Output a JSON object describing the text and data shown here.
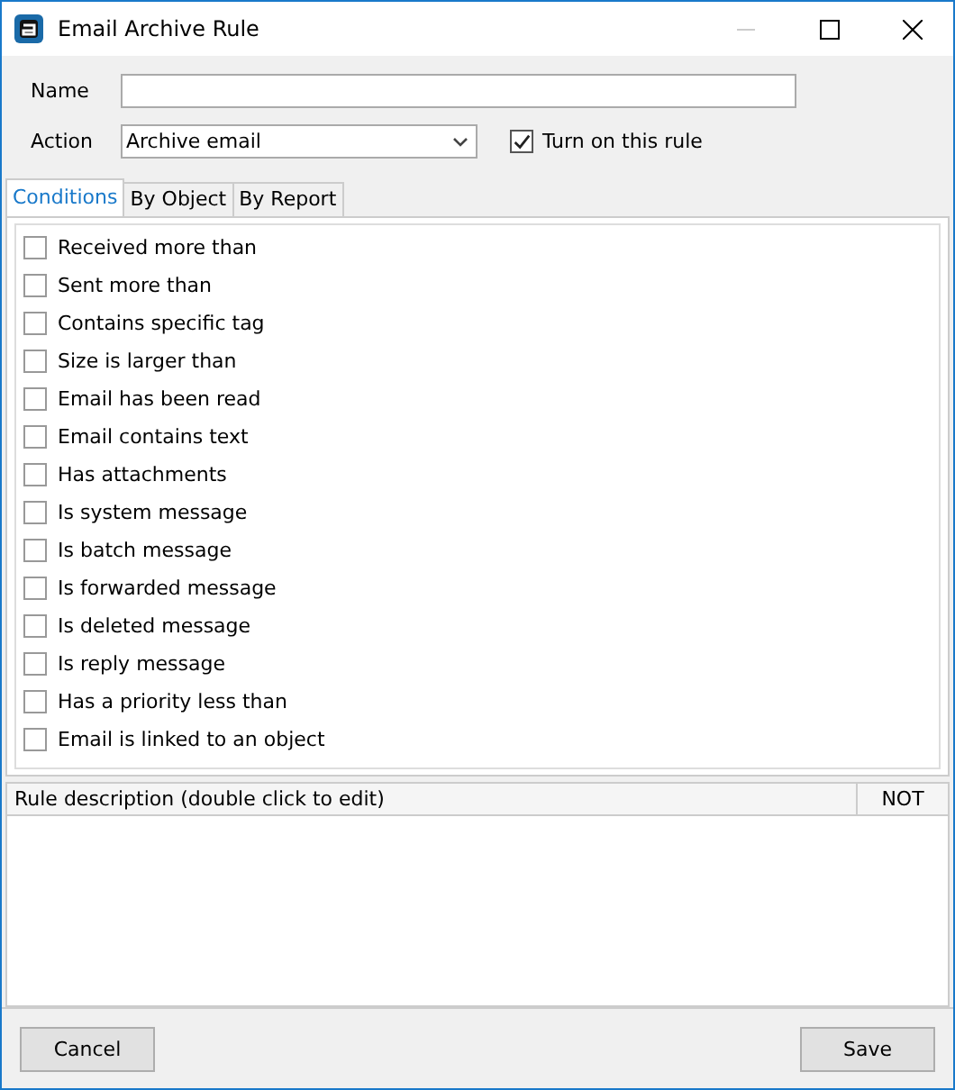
{
  "window": {
    "title": "Email Archive Rule"
  },
  "form": {
    "name_label": "Name",
    "action_label": "Action",
    "action_value": "Archive email",
    "enable": {
      "label": "Turn on this rule",
      "checked": true
    }
  },
  "tabs": [
    {
      "label": "Conditions",
      "selected": true
    },
    {
      "label": "By Object",
      "selected": false
    },
    {
      "label": "By Report",
      "selected": false
    }
  ],
  "conditions": [
    {
      "label": "Received more than",
      "checked": false
    },
    {
      "label": "Sent more than",
      "checked": false
    },
    {
      "label": "Contains specific tag",
      "checked": false
    },
    {
      "label": "Size is larger than",
      "checked": false
    },
    {
      "label": "Email has been read",
      "checked": false
    },
    {
      "label": "Email contains text",
      "checked": false
    },
    {
      "label": "Has attachments",
      "checked": false
    },
    {
      "label": "Is system message",
      "checked": false
    },
    {
      "label": "Is batch message",
      "checked": false
    },
    {
      "label": "Is forwarded message",
      "checked": false
    },
    {
      "label": "Is deleted message",
      "checked": false
    },
    {
      "label": "Is reply message",
      "checked": false
    },
    {
      "label": "Has a priority less than",
      "checked": false
    },
    {
      "label": "Email is linked to an object",
      "checked": false
    }
  ],
  "description_table": {
    "columns": [
      "Rule description (double click to edit)",
      "NOT"
    ]
  },
  "buttons": {
    "cancel": "Cancel",
    "save": "Save"
  }
}
